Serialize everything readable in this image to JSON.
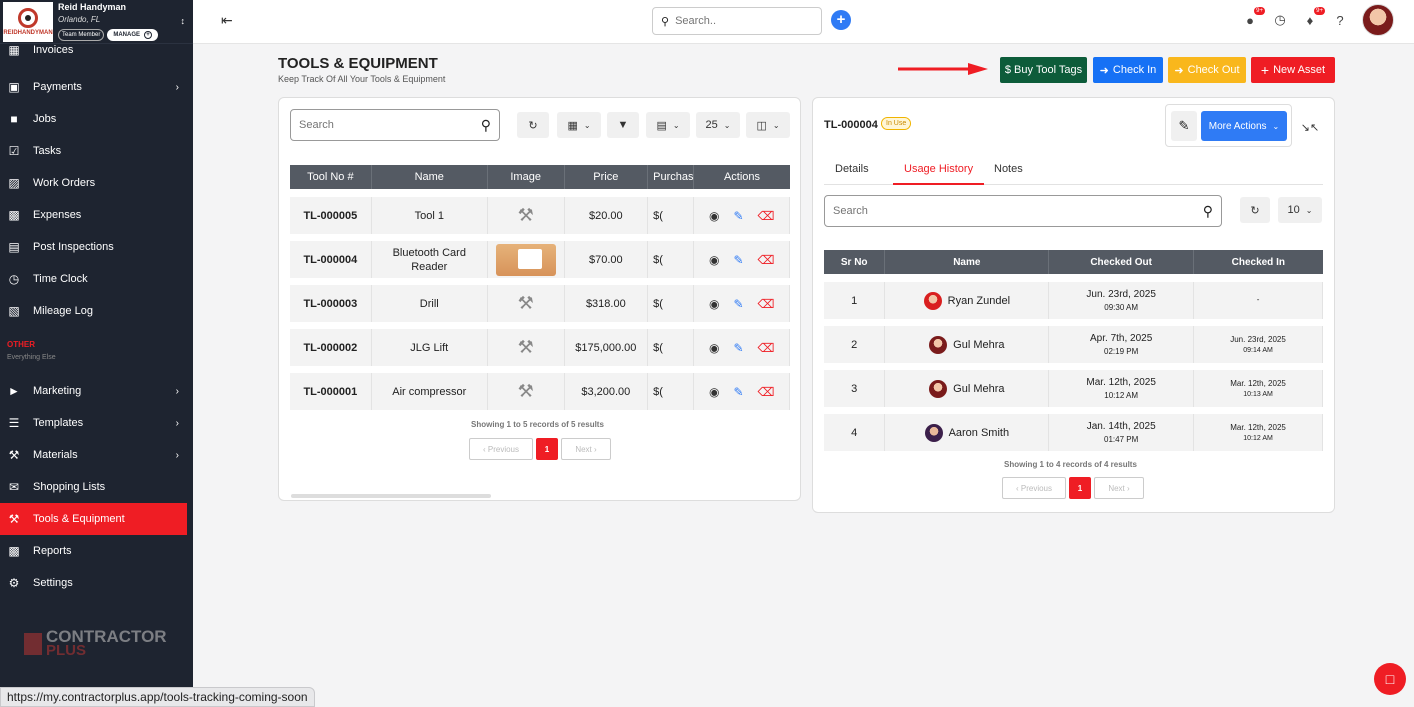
{
  "brand": {
    "name": "Reid Handyman",
    "location": "Orlando, FL",
    "role_badge": "Team Member",
    "manage_label": "MANAGE",
    "logo_text": "REIDHANDYMAN"
  },
  "sidebar": {
    "items": [
      {
        "label": "Invoices",
        "icon": "invoice-icon",
        "has_chevron": false
      },
      {
        "label": "Payments",
        "icon": "payments-icon",
        "has_chevron": true
      },
      {
        "label": "Jobs",
        "icon": "briefcase-icon",
        "has_chevron": false
      },
      {
        "label": "Tasks",
        "icon": "tasks-icon",
        "has_chevron": false
      },
      {
        "label": "Work Orders",
        "icon": "work-orders-icon",
        "has_chevron": false
      },
      {
        "label": "Expenses",
        "icon": "expenses-icon",
        "has_chevron": false
      },
      {
        "label": "Post Inspections",
        "icon": "inspection-icon",
        "has_chevron": false
      },
      {
        "label": "Time Clock",
        "icon": "clock-icon",
        "has_chevron": false
      },
      {
        "label": "Mileage Log",
        "icon": "mileage-icon",
        "has_chevron": false
      }
    ],
    "other_heading": "OTHER",
    "other_subheading": "Everything Else",
    "other_items": [
      {
        "label": "Marketing",
        "icon": "marketing-icon",
        "has_chevron": true
      },
      {
        "label": "Templates",
        "icon": "templates-icon",
        "has_chevron": true
      },
      {
        "label": "Materials",
        "icon": "materials-icon",
        "has_chevron": true
      },
      {
        "label": "Shopping Lists",
        "icon": "shopping-list-icon",
        "has_chevron": false
      },
      {
        "label": "Tools & Equipment",
        "icon": "tools-icon",
        "has_chevron": false,
        "active": true
      },
      {
        "label": "Reports",
        "icon": "reports-icon",
        "has_chevron": false
      },
      {
        "label": "Settings",
        "icon": "gear-icon",
        "has_chevron": false
      }
    ],
    "footer_logo_line1": "CONTRACTOR",
    "footer_logo_line2": "PLUS"
  },
  "topbar": {
    "search_placeholder": "Search..",
    "badge_count_1": "9+",
    "badge_count_2": "9+"
  },
  "page": {
    "title": "TOOLS & EQUIPMENT",
    "subtitle": "Keep Track Of All Your Tools & Equipment",
    "buttons": {
      "buy_tags": "$ Buy Tool Tags",
      "check_in": "Check In",
      "check_out": "Check Out",
      "new_asset": "New Asset"
    },
    "colors": {
      "buy_tags": "#0d5c3a",
      "check_in": "#1671f5",
      "check_out": "#f9b71c",
      "new_asset": "#ef1d24",
      "accent": "#ef1d24"
    }
  },
  "tools": {
    "search_placeholder": "Search",
    "page_size": "25",
    "columns": [
      "Tool No #",
      "Name",
      "Image",
      "Price",
      "Purchas",
      "Actions"
    ],
    "rows": [
      {
        "tool_no": "TL-000005",
        "name": "Tool 1",
        "price": "$20.00",
        "purchase": "$("
      },
      {
        "tool_no": "TL-000004",
        "name": "Bluetooth Card Reader",
        "price": "$70.00",
        "purchase": "$("
      },
      {
        "tool_no": "TL-000003",
        "name": "Drill",
        "price": "$318.00",
        "purchase": "$("
      },
      {
        "tool_no": "TL-000002",
        "name": "JLG Lift",
        "price": "$175,000.00",
        "purchase": "$("
      },
      {
        "tool_no": "TL-000001",
        "name": "Air compressor",
        "price": "$3,200.00",
        "purchase": "$("
      }
    ],
    "showing": "Showing 1 to 5 records of 5 results",
    "pager": {
      "prev": "Previous",
      "current": "1",
      "next": "Next"
    }
  },
  "detail": {
    "tool_id": "TL-000004",
    "status": "In Use",
    "more_actions": "More Actions",
    "tabs": [
      "Details",
      "Usage History",
      "Notes"
    ],
    "active_tab": "Usage History",
    "search_placeholder": "Search",
    "page_size": "10",
    "columns": [
      "Sr No",
      "Name",
      "Checked Out",
      "Checked In"
    ],
    "rows": [
      {
        "sr": "1",
        "name": "Ryan Zundel",
        "out_date": "Jun. 23rd, 2025",
        "out_time": "09:30 AM",
        "in_date": "-",
        "in_time": ""
      },
      {
        "sr": "2",
        "name": "Gul Mehra",
        "out_date": "Apr. 7th, 2025",
        "out_time": "02:19 PM",
        "in_date": "Jun. 23rd, 2025",
        "in_time": "09:14 AM"
      },
      {
        "sr": "3",
        "name": "Gul Mehra",
        "out_date": "Mar. 12th, 2025",
        "out_time": "10:12 AM",
        "in_date": "Mar. 12th, 2025",
        "in_time": "10:13 AM"
      },
      {
        "sr": "4",
        "name": "Aaron Smith",
        "out_date": "Jan. 14th, 2025",
        "out_time": "01:47 PM",
        "in_date": "Mar. 12th, 2025",
        "in_time": "10:12 AM"
      }
    ],
    "showing": "Showing 1 to 4 records of 4 results",
    "pager": {
      "prev": "Previous",
      "current": "1",
      "next": "Next"
    }
  },
  "status_url": "https://my.contractorplus.app/tools-tracking-coming-soon"
}
